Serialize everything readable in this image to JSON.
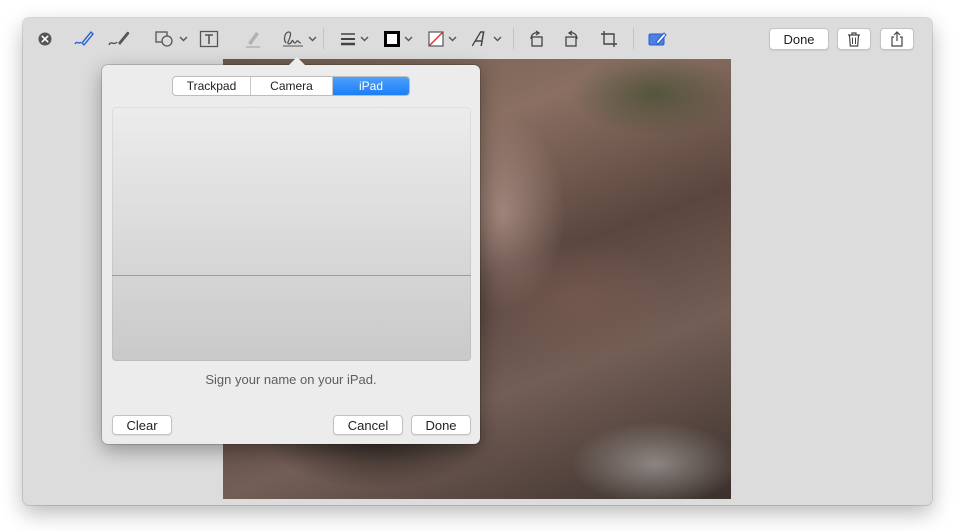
{
  "toolbar": {
    "tools": [
      "close-icon",
      "sketch-icon",
      "draw-icon",
      "shapes-icon",
      "text-icon",
      "highlight-icon",
      "sign-icon",
      "line-style-icon",
      "border-color-icon",
      "fill-color-icon",
      "text-style-icon",
      "rotate-left-icon",
      "rotate-right-icon",
      "crop-icon",
      "annotate-icon"
    ],
    "done_label": "Done",
    "trash_icon": "trash-icon",
    "share_icon": "share-icon"
  },
  "signature_popover": {
    "tabs": [
      {
        "label": "Trackpad",
        "active": false
      },
      {
        "label": "Camera",
        "active": false
      },
      {
        "label": "iPad",
        "active": true
      }
    ],
    "instruction": "Sign your name on your iPad.",
    "clear_label": "Clear",
    "cancel_label": "Cancel",
    "done_label": "Done"
  },
  "colors": {
    "accent": "#1b7ef6",
    "pad_baseline": "#7d9ee6",
    "window_bg": "#dcdcdc"
  }
}
